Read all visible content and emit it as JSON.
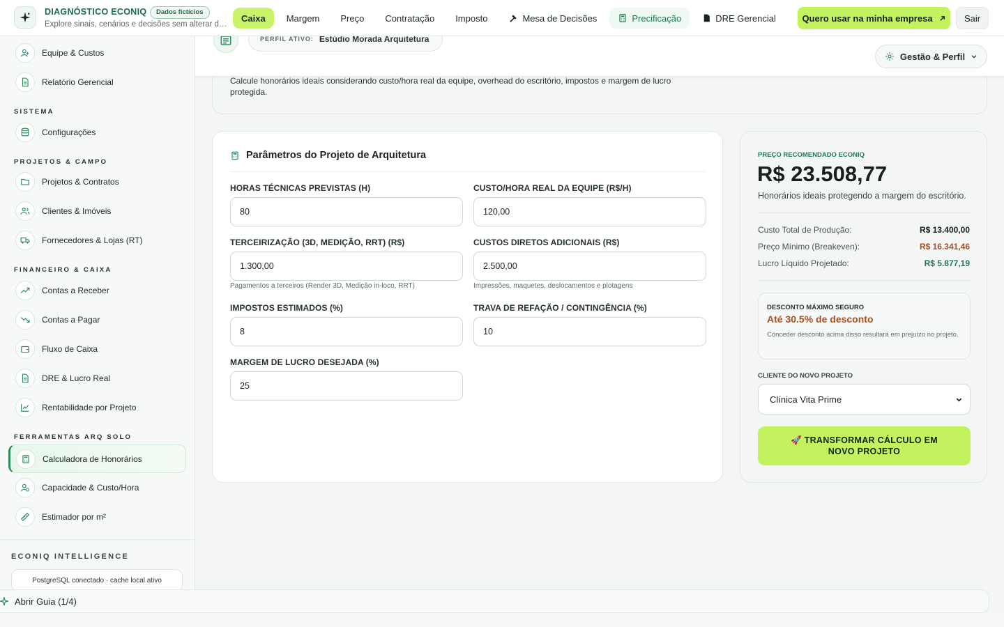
{
  "brand": {
    "title": "DIAGNÓSTICO ECONIQ",
    "badge": "Dados fictícios",
    "subtitle": "Explore sinais, cenários e decisões sem alterar da..."
  },
  "nav": [
    {
      "label": "Caixa",
      "icon": ""
    },
    {
      "label": "Margem",
      "icon": ""
    },
    {
      "label": "Preço",
      "icon": ""
    },
    {
      "label": "Contratação",
      "icon": ""
    },
    {
      "label": "Imposto",
      "icon": ""
    },
    {
      "label": "Mesa de Decisões",
      "icon": "gavel-icon"
    },
    {
      "label": "Precificação",
      "icon": "calculator-icon"
    },
    {
      "label": "DRE Gerencial",
      "icon": "document-icon"
    }
  ],
  "header_actions": {
    "cta_label": "Quero usar na minha empresa",
    "logout_label": "Sair"
  },
  "sidebar": {
    "items_top": [
      {
        "label": "Equipe & Custos",
        "icon": "user-icon"
      },
      {
        "label": "Relatório Gerencial",
        "icon": "document-icon"
      }
    ],
    "sections": [
      {
        "title": "SISTEMA",
        "items": [
          {
            "label": "Configurações",
            "icon": "database-icon"
          }
        ]
      },
      {
        "title": "PROJETOS & CAMPO",
        "items": [
          {
            "label": "Projetos & Contratos",
            "icon": "folder-icon"
          },
          {
            "label": "Clientes & Imóveis",
            "icon": "users-icon"
          },
          {
            "label": "Fornecedores & Lojas (RT)",
            "icon": "truck-icon"
          }
        ]
      },
      {
        "title": "FINANCEIRO & CAIXA",
        "items": [
          {
            "label": "Contas a Receber",
            "icon": "trend-up-icon"
          },
          {
            "label": "Contas a Pagar",
            "icon": "trend-down-icon"
          },
          {
            "label": "Fluxo de Caixa",
            "icon": "wallet-icon"
          },
          {
            "label": "DRE & Lucro Real",
            "icon": "document-icon"
          },
          {
            "label": "Rentabilidade por Projeto",
            "icon": "line-chart-icon"
          }
        ]
      },
      {
        "title": "FERRAMENTAS ARQ SOLO",
        "items": [
          {
            "label": "Calculadora de Honorários",
            "icon": "calculator-icon"
          },
          {
            "label": "Capacidade & Custo/Hora",
            "icon": "user-clock-icon"
          },
          {
            "label": "Estimador por m²",
            "icon": "ruler-icon"
          }
        ]
      }
    ],
    "intelligence_title": "ECONIQ INTELLIGENCE",
    "status": "PostgreSQL conectado · cache local ativo"
  },
  "profile": {
    "label": "PERFIL ATIVO:",
    "value": "Estúdio Morada Arquitetura",
    "menu_label": "Gestão & Perfil"
  },
  "intro": {
    "text": "Calcule honorários ideais considerando custo/hora real da equipe, overhead do escritório, impostos e margem de lucro protegida."
  },
  "params": {
    "title": "Parâmetros do Projeto de Arquitetura",
    "fields": [
      {
        "label": "HORAS TÉCNICAS PREVISTAS (H)",
        "value": "80",
        "help": ""
      },
      {
        "label": "CUSTO/HORA REAL DA EQUIPE (R$/H)",
        "value": "120,00",
        "help": ""
      },
      {
        "label": "TERCEIRIZAÇÃO (3D, MEDIÇÃO, RRT) (R$)",
        "value": "1.300,00",
        "help": "Pagamentos a terceiros (Render 3D, Medição in-loco, RRT)"
      },
      {
        "label": "CUSTOS DIRETOS ADICIONAIS (R$)",
        "value": "2.500,00",
        "help": "Impressões, maquetes, deslocamentos e plotagens"
      },
      {
        "label": "IMPOSTOS ESTIMADOS (%)",
        "value": "8",
        "help": ""
      },
      {
        "label": "TRAVA DE REFAÇÃO / CONTINGÊNCIA (%)",
        "value": "10",
        "help": ""
      },
      {
        "label": "MARGEM DE LUCRO DESEJADA (%)",
        "value": "25",
        "help": ""
      }
    ]
  },
  "result": {
    "eyebrow": "PREÇO RECOMENDADO ECONIQ",
    "price": "R$ 23.508,77",
    "subtitle": "Honorários ideais protegendo a margem do escritório.",
    "rows": [
      {
        "label": "Custo Total de Produção:",
        "value": "R$ 13.400,00",
        "color": "#16211c"
      },
      {
        "label": "Preço Mínimo (Breakeven):",
        "value": "R$ 16.341,46",
        "color": "#a8501f"
      },
      {
        "label": "Lucro Líquido Projetado:",
        "value": "R$ 5.877,19",
        "color": "#1f7a51"
      }
    ],
    "discount": {
      "label": "DESCONTO MÁXIMO SEGURO",
      "value": "Até 30.5% de desconto",
      "note": "Conceder desconto acima disso resultará em prejuízo no projeto."
    },
    "client_label": "CLIENTE DO NOVO PROJETO",
    "client_value": "Clínica Vita Prime",
    "button_label": "🚀 TRANSFORMAR CÁLCULO EM NOVO PROJETO"
  },
  "guide": {
    "label": "Abrir Guia (1/4)"
  }
}
